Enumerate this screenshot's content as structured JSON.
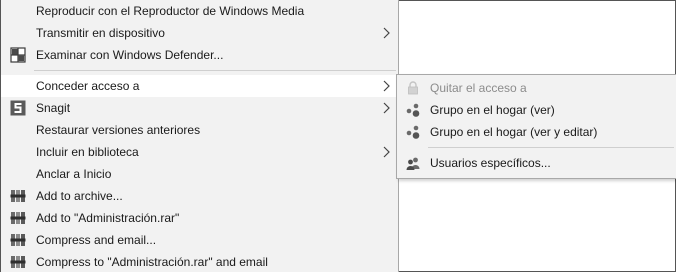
{
  "menu": {
    "items": [
      {
        "label": "Reproducir con el Reproductor de Windows Media"
      },
      {
        "label": "Transmitir en dispositivo"
      },
      {
        "label": "Examinar con Windows Defender..."
      },
      {
        "label": "Conceder acceso a"
      },
      {
        "label": "Snagit"
      },
      {
        "label": "Restaurar versiones anteriores"
      },
      {
        "label": "Incluir en biblioteca"
      },
      {
        "label": "Anclar a Inicio"
      },
      {
        "label": "Add to archive..."
      },
      {
        "label": "Add to \"Administración.rar\""
      },
      {
        "label": "Compress and email..."
      },
      {
        "label": "Compress to \"Administración.rar\" and email"
      }
    ]
  },
  "submenu": {
    "items": [
      {
        "label": "Quitar el acceso a"
      },
      {
        "label": "Grupo en el hogar (ver)"
      },
      {
        "label": "Grupo en el hogar (ver y editar)"
      },
      {
        "label": "Usuarios específicos..."
      }
    ]
  },
  "icons": {
    "defender": "shield-icon",
    "snagit": "snagit-icon",
    "winrar": "winrar-icon",
    "lock": "lock-icon",
    "homegroup": "homegroup-icon",
    "users": "users-icon",
    "submenu_arrow": "chevron-right-icon"
  },
  "colors": {
    "menu_bg": "#f2f2f2",
    "highlight_bg": "#ffffff",
    "disabled_text": "#8c8c8c",
    "separator": "#cfcfcf"
  }
}
